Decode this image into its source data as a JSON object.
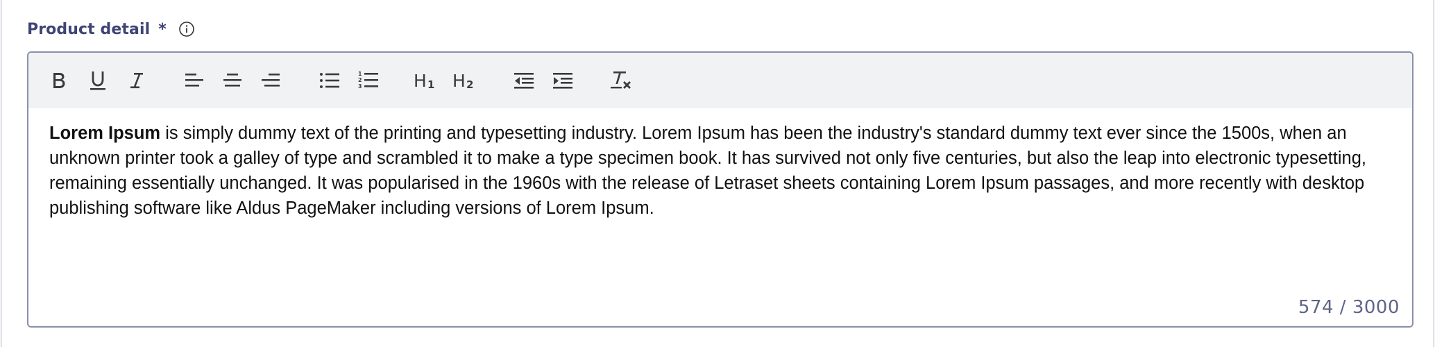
{
  "field": {
    "label": "Product detail",
    "required_mark": "*",
    "info_icon": "info-circle-icon"
  },
  "toolbar": {
    "buttons": [
      {
        "name": "bold",
        "icon": "bold-icon"
      },
      {
        "name": "underline",
        "icon": "underline-icon"
      },
      {
        "name": "italic",
        "icon": "italic-icon"
      },
      {
        "name": "align-left",
        "icon": "align-left-icon"
      },
      {
        "name": "align-center",
        "icon": "align-center-icon"
      },
      {
        "name": "align-right",
        "icon": "align-right-icon"
      },
      {
        "name": "bullet-list",
        "icon": "bullet-list-icon"
      },
      {
        "name": "numbered-list",
        "icon": "numbered-list-icon"
      },
      {
        "name": "heading-1",
        "icon": "heading-1-icon"
      },
      {
        "name": "heading-2",
        "icon": "heading-2-icon"
      },
      {
        "name": "outdent",
        "icon": "outdent-icon"
      },
      {
        "name": "indent",
        "icon": "indent-icon"
      },
      {
        "name": "clear-formatting",
        "icon": "clear-formatting-icon"
      }
    ]
  },
  "editor": {
    "bold_lead": "Lorem Ipsum",
    "body_text": " is simply dummy text of the printing and typesetting industry. Lorem Ipsum has been the industry's standard dummy text ever since the 1500s, when an unknown printer took a galley of type and scrambled it to make a type specimen book. It has survived not only five centuries, but also the leap into electronic typesetting, remaining essentially unchanged. It was popularised in the 1960s with the release of Letraset sheets containing Lorem Ipsum passages, and more recently with desktop publishing software like Aldus PageMaker including versions of Lorem Ipsum.",
    "char_count": "574 / 3000"
  },
  "colors": {
    "label": "#3f4476",
    "border": "#8a8ead",
    "toolbar_bg": "#f1f2f4",
    "counter": "#5f6488"
  }
}
